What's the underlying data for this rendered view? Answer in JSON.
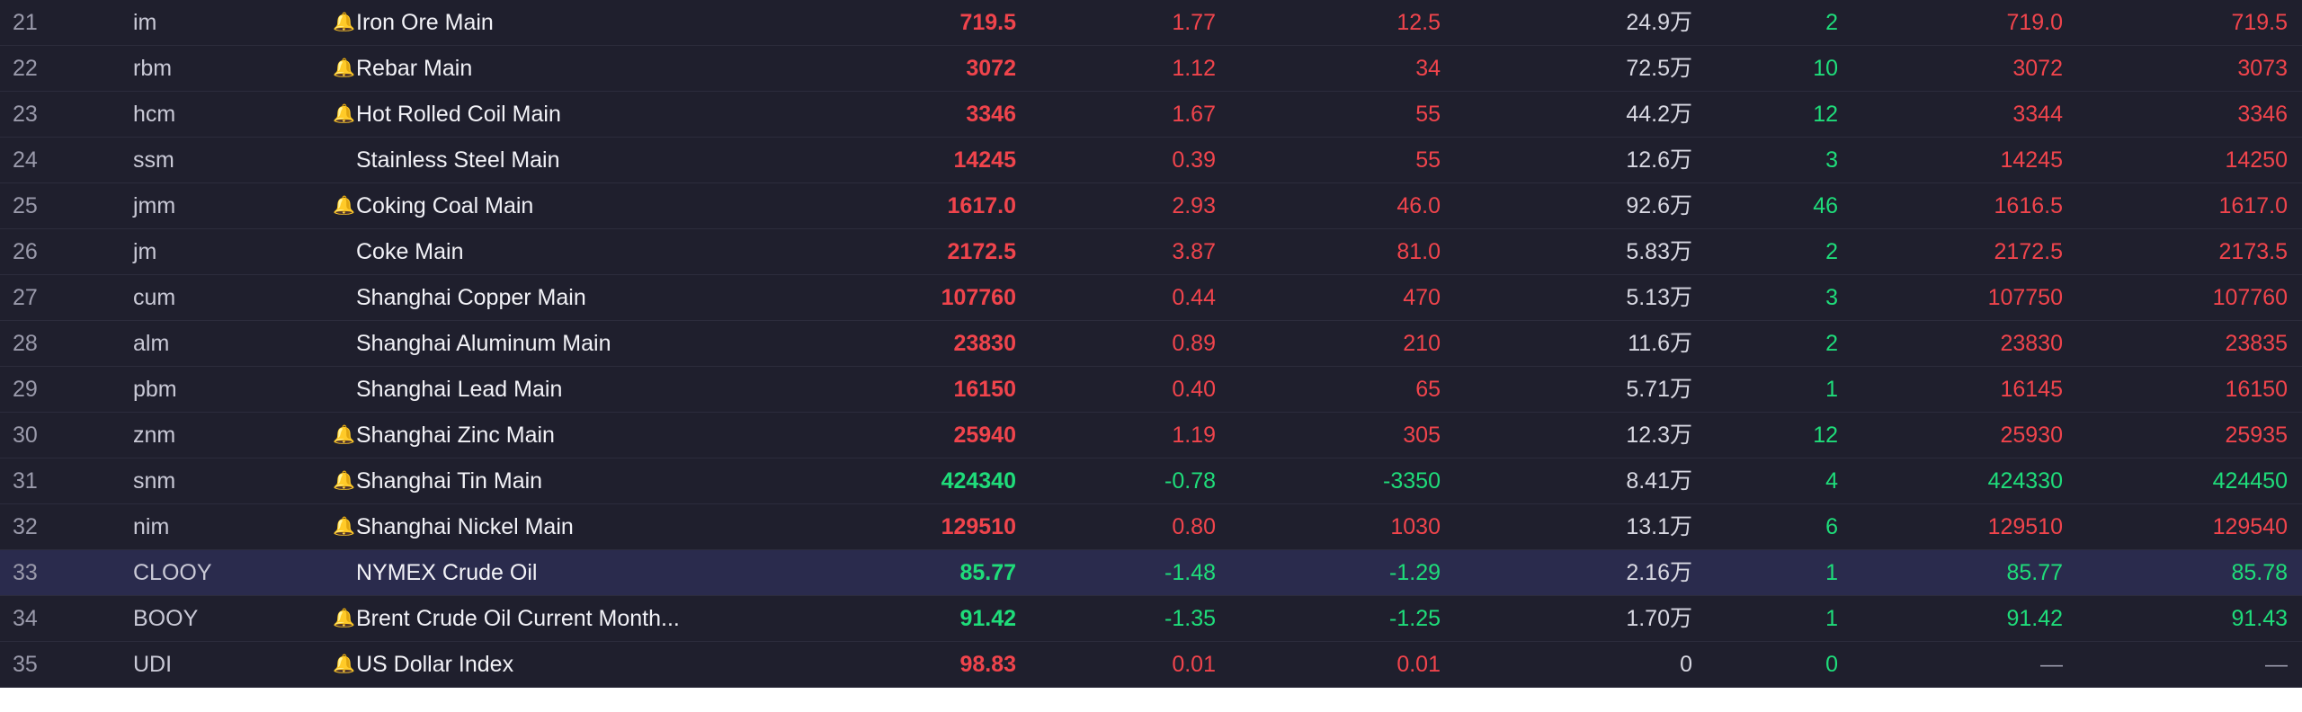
{
  "colors": {
    "background": "#1f1f2d",
    "selected_row": "#2a2b4d",
    "up": "#f0444c",
    "down": "#1fdc7a",
    "neutral": "#9a9aab"
  },
  "alert_icon": "bell-icon",
  "rows": [
    {
      "idx": "21",
      "code": "im",
      "alert": true,
      "name": "Iron Ore Main",
      "price": "719.5",
      "pct": "1.77",
      "chg": "12.5",
      "vol": "24.9万",
      "size": "2",
      "bid": "719.0",
      "ask": "719.5",
      "trend": "up",
      "size_trend": "down",
      "selected": false
    },
    {
      "idx": "22",
      "code": "rbm",
      "alert": true,
      "name": "Rebar Main",
      "price": "3072",
      "pct": "1.12",
      "chg": "34",
      "vol": "72.5万",
      "size": "10",
      "bid": "3072",
      "ask": "3073",
      "trend": "up",
      "size_trend": "down",
      "selected": false
    },
    {
      "idx": "23",
      "code": "hcm",
      "alert": true,
      "name": "Hot Rolled Coil Main",
      "price": "3346",
      "pct": "1.67",
      "chg": "55",
      "vol": "44.2万",
      "size": "12",
      "bid": "3344",
      "ask": "3346",
      "trend": "up",
      "size_trend": "down",
      "selected": false
    },
    {
      "idx": "24",
      "code": "ssm",
      "alert": false,
      "name": "Stainless Steel Main",
      "price": "14245",
      "pct": "0.39",
      "chg": "55",
      "vol": "12.6万",
      "size": "3",
      "bid": "14245",
      "ask": "14250",
      "trend": "up",
      "size_trend": "down",
      "selected": false
    },
    {
      "idx": "25",
      "code": "jmm",
      "alert": true,
      "name": "Coking Coal Main",
      "price": "1617.0",
      "pct": "2.93",
      "chg": "46.0",
      "vol": "92.6万",
      "size": "46",
      "bid": "1616.5",
      "ask": "1617.0",
      "trend": "up",
      "size_trend": "down",
      "selected": false
    },
    {
      "idx": "26",
      "code": "jm",
      "alert": false,
      "name": "Coke Main",
      "price": "2172.5",
      "pct": "3.87",
      "chg": "81.0",
      "vol": "5.83万",
      "size": "2",
      "bid": "2172.5",
      "ask": "2173.5",
      "trend": "up",
      "size_trend": "down",
      "selected": false
    },
    {
      "idx": "27",
      "code": "cum",
      "alert": false,
      "name": "Shanghai Copper Main",
      "price": "107760",
      "pct": "0.44",
      "chg": "470",
      "vol": "5.13万",
      "size": "3",
      "bid": "107750",
      "ask": "107760",
      "trend": "up",
      "size_trend": "down",
      "selected": false
    },
    {
      "idx": "28",
      "code": "alm",
      "alert": false,
      "name": "Shanghai Aluminum Main",
      "price": "23830",
      "pct": "0.89",
      "chg": "210",
      "vol": "11.6万",
      "size": "2",
      "bid": "23830",
      "ask": "23835",
      "trend": "up",
      "size_trend": "down",
      "selected": false
    },
    {
      "idx": "29",
      "code": "pbm",
      "alert": false,
      "name": "Shanghai Lead Main",
      "price": "16150",
      "pct": "0.40",
      "chg": "65",
      "vol": "5.71万",
      "size": "1",
      "bid": "16145",
      "ask": "16150",
      "trend": "up",
      "size_trend": "down",
      "selected": false
    },
    {
      "idx": "30",
      "code": "znm",
      "alert": true,
      "name": "Shanghai Zinc Main",
      "price": "25940",
      "pct": "1.19",
      "chg": "305",
      "vol": "12.3万",
      "size": "12",
      "bid": "25930",
      "ask": "25935",
      "trend": "up",
      "size_trend": "down",
      "selected": false
    },
    {
      "idx": "31",
      "code": "snm",
      "alert": true,
      "name": "Shanghai Tin Main",
      "price": "424340",
      "pct": "-0.78",
      "chg": "-3350",
      "vol": "8.41万",
      "size": "4",
      "bid": "424330",
      "ask": "424450",
      "trend": "down",
      "size_trend": "down",
      "selected": false
    },
    {
      "idx": "32",
      "code": "nim",
      "alert": true,
      "name": "Shanghai Nickel Main",
      "price": "129510",
      "pct": "0.80",
      "chg": "1030",
      "vol": "13.1万",
      "size": "6",
      "bid": "129510",
      "ask": "129540",
      "trend": "up",
      "size_trend": "down",
      "selected": false
    },
    {
      "idx": "33",
      "code": "CLOOY",
      "alert": false,
      "name": "NYMEX Crude Oil",
      "price": "85.77",
      "pct": "-1.48",
      "chg": "-1.29",
      "vol": "2.16万",
      "size": "1",
      "bid": "85.77",
      "ask": "85.78",
      "trend": "down",
      "size_trend": "down",
      "selected": true
    },
    {
      "idx": "34",
      "code": "BOOY",
      "alert": true,
      "name": "Brent Crude Oil Current Month...",
      "price": "91.42",
      "pct": "-1.35",
      "chg": "-1.25",
      "vol": "1.70万",
      "size": "1",
      "bid": "91.42",
      "ask": "91.43",
      "trend": "down",
      "size_trend": "down",
      "selected": false
    },
    {
      "idx": "35",
      "code": "UDI",
      "alert": true,
      "name": "US Dollar Index",
      "price": "98.83",
      "pct": "0.01",
      "chg": "0.01",
      "vol": "0",
      "size": "0",
      "bid": "—",
      "ask": "—",
      "trend": "up",
      "size_trend": "down",
      "selected": false,
      "vol_zero": true,
      "quote_flat": true
    }
  ]
}
